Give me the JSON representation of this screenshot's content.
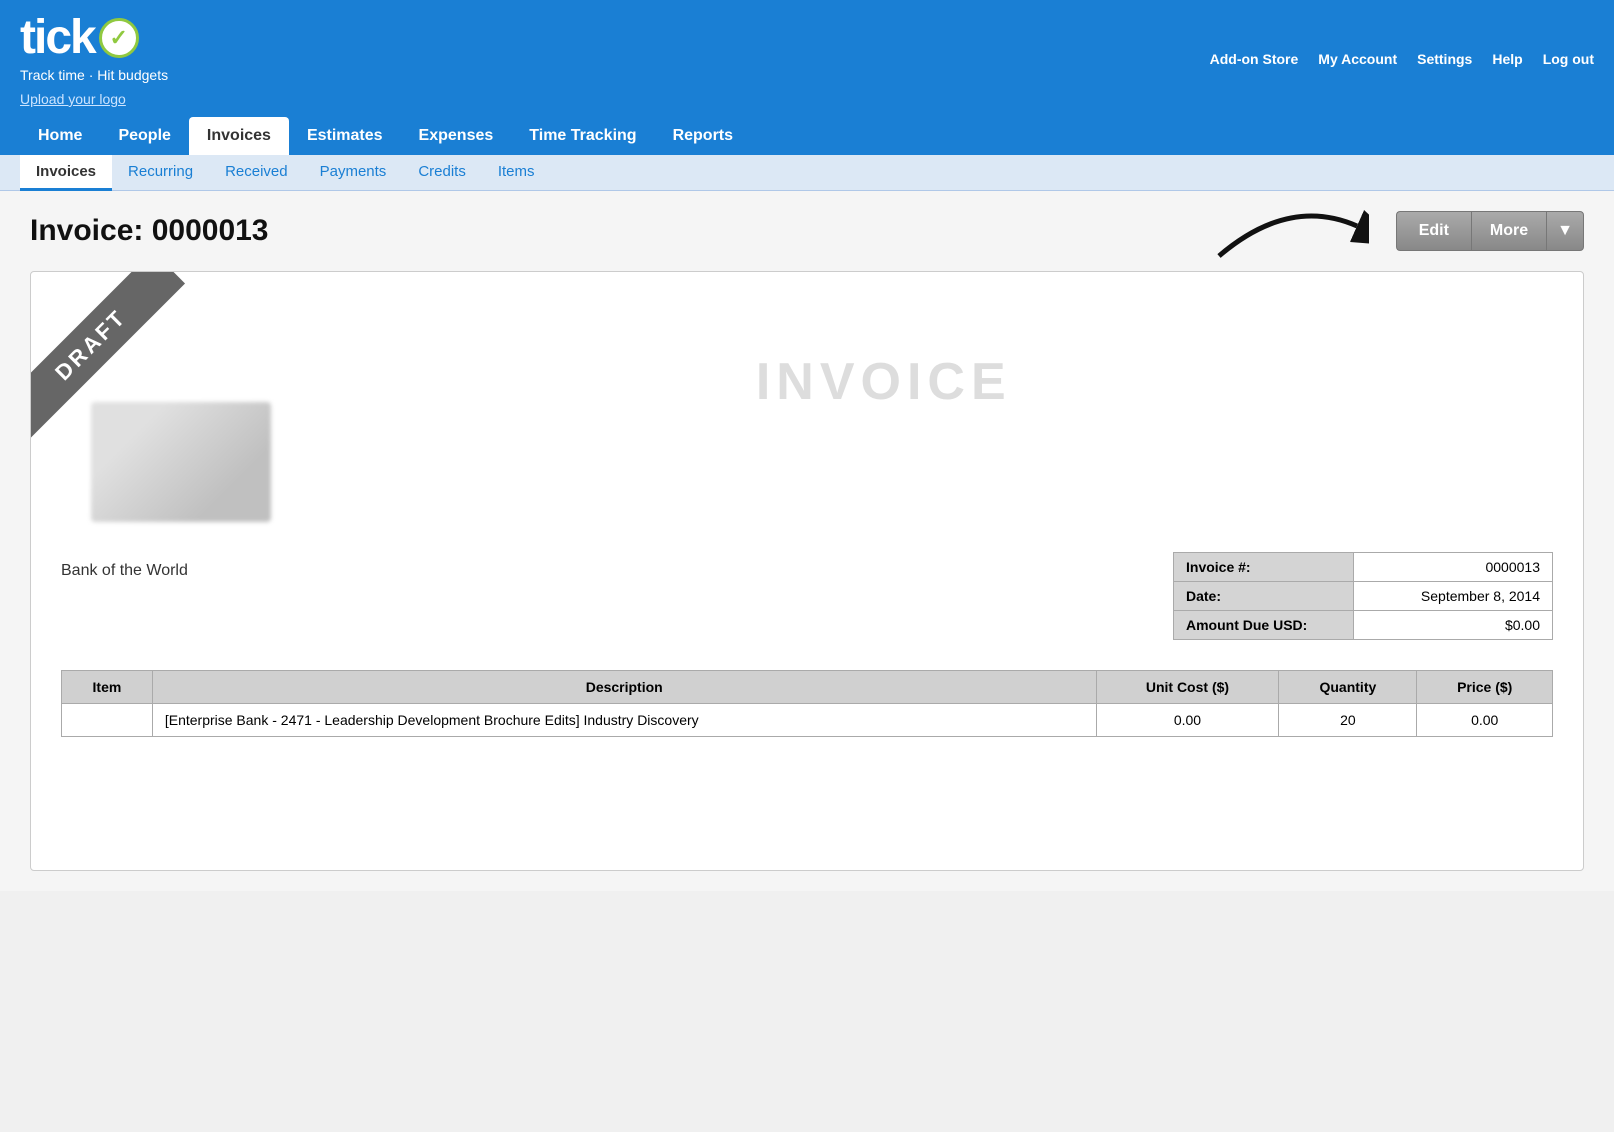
{
  "app": {
    "name": "tick",
    "tagline": "Track time · Hit budgets",
    "upload_logo": "Upload your logo"
  },
  "top_nav": {
    "links": [
      {
        "label": "Add-on Store",
        "name": "addon-store-link"
      },
      {
        "label": "My Account",
        "name": "my-account-link"
      },
      {
        "label": "Settings",
        "name": "settings-link"
      },
      {
        "label": "Help",
        "name": "help-link"
      },
      {
        "label": "Log out",
        "name": "logout-link"
      }
    ]
  },
  "main_nav": {
    "items": [
      {
        "label": "Home",
        "name": "nav-home",
        "active": false
      },
      {
        "label": "People",
        "name": "nav-people",
        "active": false
      },
      {
        "label": "Invoices",
        "name": "nav-invoices",
        "active": true
      },
      {
        "label": "Estimates",
        "name": "nav-estimates",
        "active": false
      },
      {
        "label": "Expenses",
        "name": "nav-expenses",
        "active": false
      },
      {
        "label": "Time Tracking",
        "name": "nav-time-tracking",
        "active": false
      },
      {
        "label": "Reports",
        "name": "nav-reports",
        "active": false
      }
    ]
  },
  "sub_nav": {
    "items": [
      {
        "label": "Invoices",
        "name": "subnav-invoices",
        "active": true
      },
      {
        "label": "Recurring",
        "name": "subnav-recurring",
        "active": false
      },
      {
        "label": "Received",
        "name": "subnav-received",
        "active": false
      },
      {
        "label": "Payments",
        "name": "subnav-payments",
        "active": false
      },
      {
        "label": "Credits",
        "name": "subnav-credits",
        "active": false
      },
      {
        "label": "Items",
        "name": "subnav-items",
        "active": false
      }
    ]
  },
  "page": {
    "title": "Invoice: 0000013",
    "buttons": {
      "edit": "Edit",
      "more": "More",
      "dropdown": "▼"
    }
  },
  "invoice": {
    "watermark": "INVOICE",
    "draft_label": "DRAFT",
    "client_name": "Bank of the World",
    "details": [
      {
        "label": "Invoice #:",
        "value": "0000013"
      },
      {
        "label": "Date:",
        "value": "September 8, 2014"
      },
      {
        "label": "Amount Due USD:",
        "value": "$0.00"
      }
    ],
    "line_items_headers": [
      "Item",
      "Description",
      "Unit Cost ($)",
      "Quantity",
      "Price ($)"
    ],
    "line_items": [
      {
        "item": "",
        "description": "[Enterprise Bank - 2471 - Leadership Development Brochure Edits] Industry Discovery",
        "unit_cost": "0.00",
        "quantity": "20",
        "price": "0.00"
      }
    ]
  }
}
